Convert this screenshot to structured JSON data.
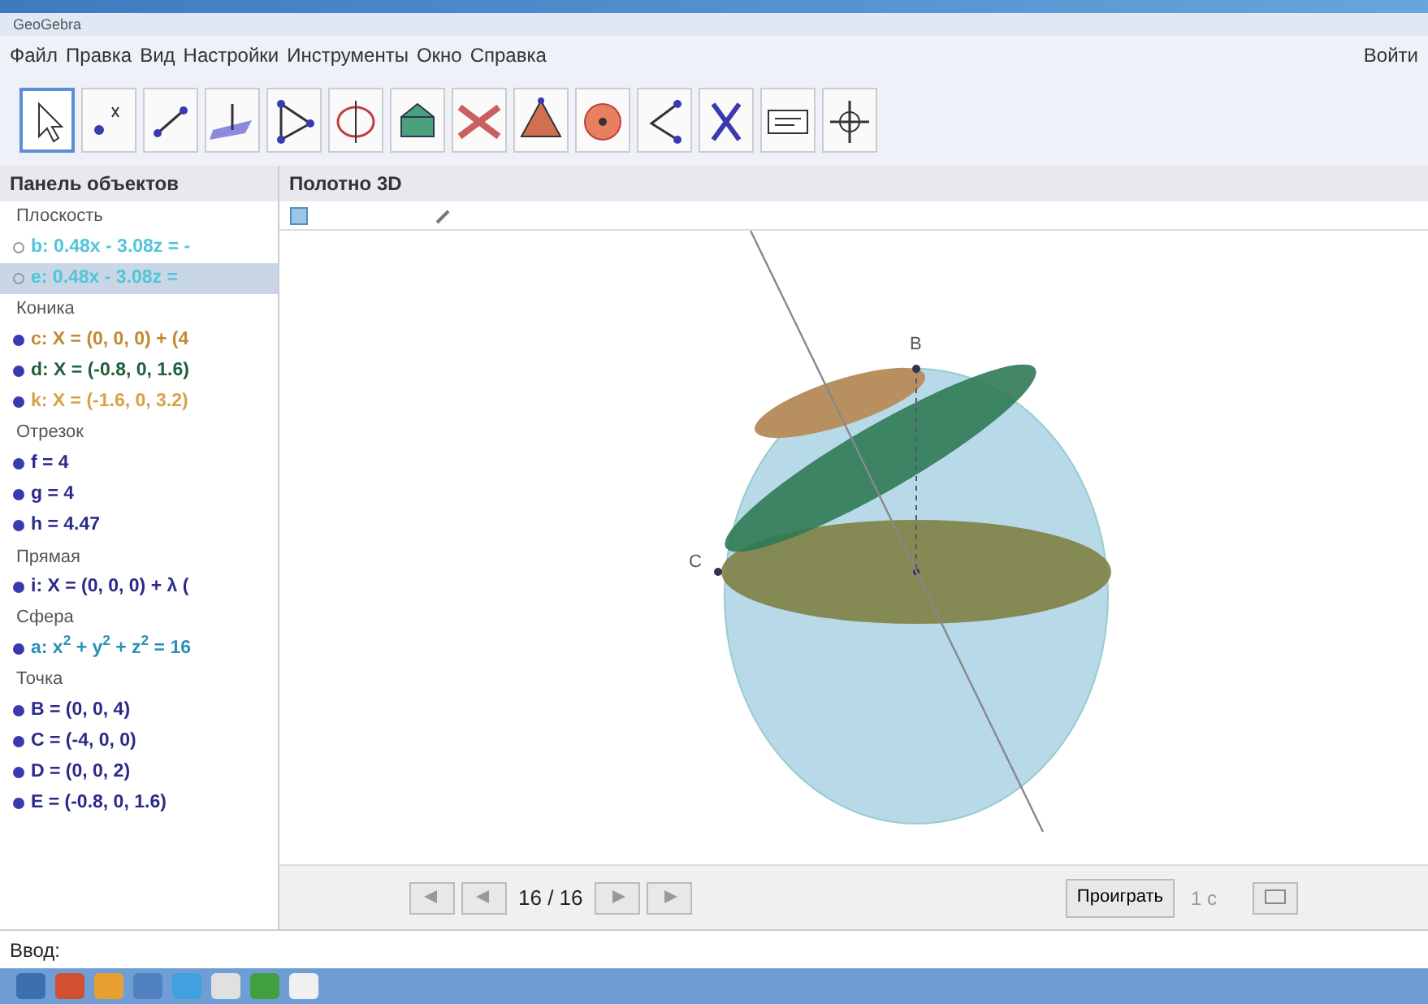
{
  "window": {
    "title": "GeoGebra"
  },
  "menu": [
    "Файл",
    "Правка",
    "Вид",
    "Настройки",
    "Инструменты",
    "Окно",
    "Справка"
  ],
  "login": "Войти",
  "tools": [
    {
      "kind": "move",
      "selected": true
    },
    {
      "kind": "point",
      "selected": false
    },
    {
      "kind": "segment",
      "selected": false
    },
    {
      "kind": "perpendicular",
      "selected": false
    },
    {
      "kind": "polygon",
      "selected": false
    },
    {
      "kind": "circle",
      "selected": false
    },
    {
      "kind": "plane",
      "selected": false
    },
    {
      "kind": "intersect",
      "selected": false
    },
    {
      "kind": "pyramid",
      "selected": false
    },
    {
      "kind": "sphere",
      "selected": false
    },
    {
      "kind": "angle",
      "selected": false
    },
    {
      "kind": "reflect",
      "selected": false
    },
    {
      "kind": "text",
      "selected": false
    },
    {
      "kind": "view",
      "selected": false
    }
  ],
  "algebra": {
    "title": "Панель объектов",
    "groups": [
      {
        "label": "Плоскость",
        "items": [
          {
            "text": "b: 0.48x - 3.08z = -",
            "color": "#4fc6d8",
            "visible": false,
            "selected": false
          },
          {
            "text": "e: 0.48x - 3.08z =",
            "color": "#4fc6d8",
            "visible": false,
            "selected": true
          }
        ]
      },
      {
        "label": "Коника",
        "items": [
          {
            "text": "c: X = (0, 0, 0) + (4",
            "color": "#c08a30",
            "visible": true,
            "selected": false
          },
          {
            "text": "d: X = (-0.8, 0, 1.6)",
            "color": "#1f5f3a",
            "visible": true,
            "selected": false
          },
          {
            "text": "k: X = (-1.6, 0, 3.2)",
            "color": "#d9a04a",
            "visible": true,
            "selected": false
          }
        ]
      },
      {
        "label": "Отрезок",
        "items": [
          {
            "text": "f = 4",
            "color": "#2a2a8a",
            "visible": true,
            "selected": false
          },
          {
            "text": "g = 4",
            "color": "#2a2a8a",
            "visible": true,
            "selected": false
          },
          {
            "text": "h = 4.47",
            "color": "#2a2a8a",
            "visible": true,
            "selected": false
          }
        ]
      },
      {
        "label": "Прямая",
        "items": [
          {
            "text": "i: X = (0, 0, 0) + λ (",
            "color": "#2a2a8a",
            "visible": true,
            "selected": false
          }
        ]
      },
      {
        "label": "Сфера",
        "items": [
          {
            "text": "a: x$^{2}$ + y$^{2}$ + z$^{2}$ = 16",
            "color": "#2b8fb8",
            "visible": true,
            "selected": false
          }
        ]
      },
      {
        "label": "Точка",
        "items": [
          {
            "text": "B = (0, 0, 4)",
            "color": "#2a2a8a",
            "visible": true,
            "selected": false
          },
          {
            "text": "C = (-4, 0, 0)",
            "color": "#2a2a8a",
            "visible": true,
            "selected": false
          },
          {
            "text": "D = (0, 0, 2)",
            "color": "#2a2a8a",
            "visible": true,
            "selected": false
          },
          {
            "text": "E = (-0.8, 0, 1.6)",
            "color": "#2a2a8a",
            "visible": true,
            "selected": false
          }
        ]
      }
    ]
  },
  "view3d": {
    "title": "Полотно 3D",
    "points": [
      {
        "label": "B"
      },
      {
        "label": "C"
      }
    ]
  },
  "playback": {
    "step": "16 / 16",
    "play": "Проиграть",
    "speed": "1 с"
  },
  "input": {
    "label": "Ввод:"
  }
}
